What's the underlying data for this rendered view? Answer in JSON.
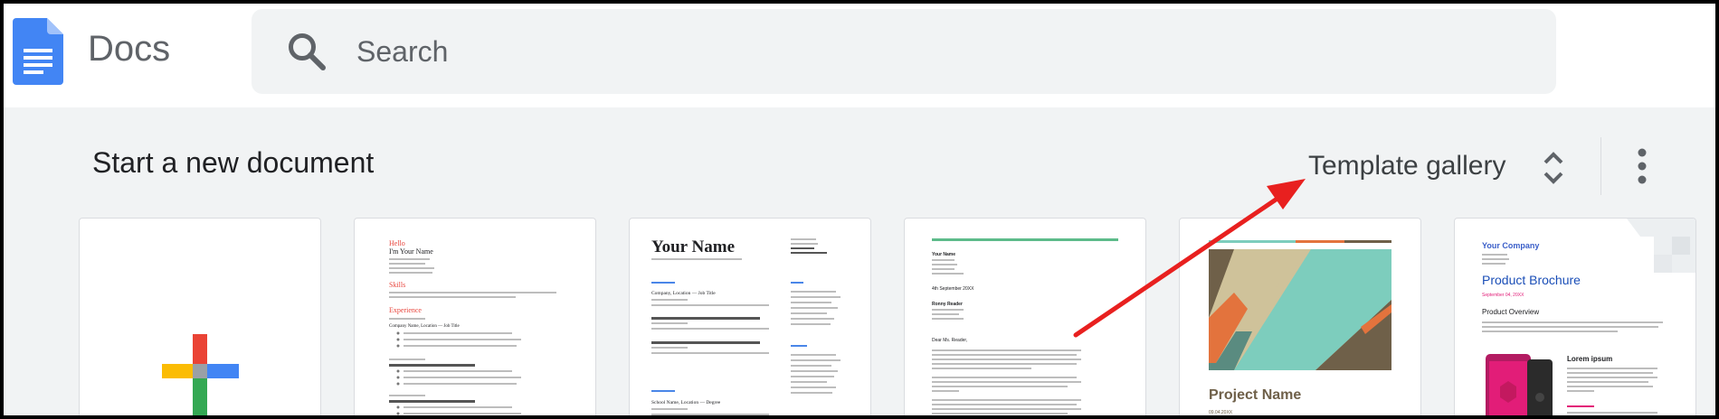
{
  "app": {
    "name": "Docs"
  },
  "search": {
    "placeholder": "Search",
    "value": ""
  },
  "section": {
    "title": "Start a new document"
  },
  "template_gallery": {
    "label": "Template gallery"
  },
  "icons": {
    "logo": "google-docs-icon",
    "search": "search-icon",
    "unfold": "unfold-more-icon",
    "more": "more-vert-icon",
    "blank_plus": "plus-icon"
  },
  "colors": {
    "docs_blue": "#4285f4",
    "plus_red": "#ea4335",
    "plus_yellow": "#fbbc04",
    "plus_green": "#34a853",
    "annotation_arrow": "#e8201f",
    "accent_green": "#5dbb8a",
    "accent_orange": "#e3733d",
    "accent_teal": "#7dcdbd",
    "brochure_blue": "#1a4eb7",
    "brochure_pink": "#e21d78"
  },
  "templates": [
    {
      "id": "blank"
    },
    {
      "id": "resume-serif",
      "hello": "Hello",
      "name": "I'm Your Name",
      "skills": "Skills",
      "experience": "Experience",
      "company": "Company Name, Location — Job Title"
    },
    {
      "id": "resume-coral",
      "name": "Your Name",
      "company": "Company, Location — Job Title",
      "school": "School Name, Location — Degree"
    },
    {
      "id": "letter-spearmint",
      "your_name": "Your Name",
      "date": "4th September 20XX",
      "recipient": "Ronny Reader",
      "greeting": "Dear Ms. Reader,"
    },
    {
      "id": "project-tropic",
      "title": "Project Name",
      "date": "09.04.20XX"
    },
    {
      "id": "brochure-geometric",
      "company": "Your Company",
      "title": "Product Brochure",
      "date": "September 04, 20XX",
      "overview": "Product Overview",
      "subheading": "Lorem ipsum"
    }
  ]
}
